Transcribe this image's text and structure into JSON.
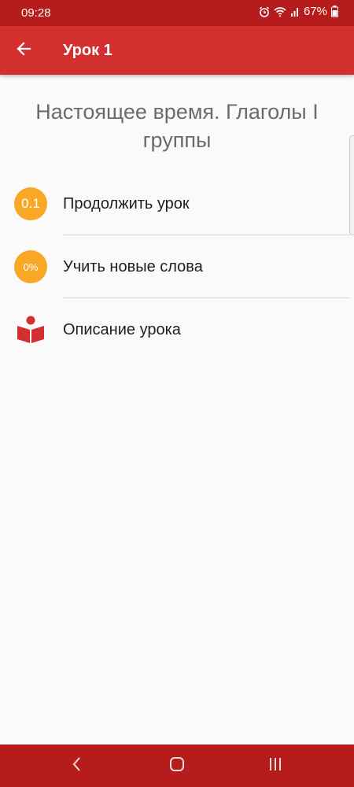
{
  "status_bar": {
    "time": "09:28",
    "battery": "67%",
    "icons": [
      "alarm-icon",
      "wifi-icon",
      "signal-icon",
      "battery-icon"
    ]
  },
  "app_bar": {
    "title": "Урок 1",
    "back_icon": "arrow-back-icon"
  },
  "lesson": {
    "title_line1": "Настоящее время. Глаголы I",
    "title_line2": "группы"
  },
  "menu": {
    "items": [
      {
        "badge": "0.1",
        "label": "Продолжить урок",
        "icon": "progress-badge-icon"
      },
      {
        "badge": "0%",
        "label": "Учить новые слова",
        "icon": "progress-badge-icon"
      },
      {
        "label": "Описание урока",
        "icon": "book-reader-icon"
      }
    ]
  },
  "colors": {
    "status_bar": "#b71c1c",
    "app_bar": "#d32f2f",
    "badge": "#f9a825",
    "book_icon": "#d32f2f",
    "background": "#fafafa",
    "title_text": "#6b6b6b"
  },
  "nav_bar": {
    "buttons": [
      "back-nav-icon",
      "home-nav-icon",
      "recents-nav-icon"
    ]
  }
}
